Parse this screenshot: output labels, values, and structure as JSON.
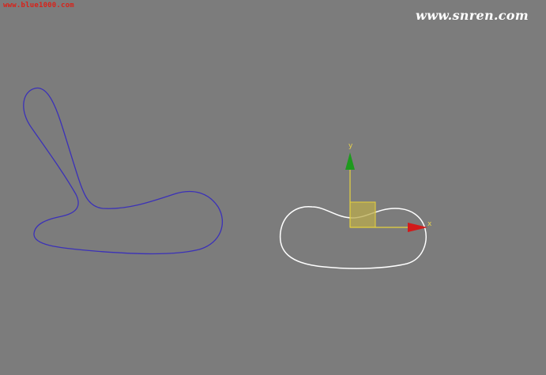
{
  "watermarks": {
    "left": "www.blue1000.com",
    "right": "www.snren.com"
  },
  "gizmo": {
    "y_label": "y",
    "x_label": "x",
    "colors": {
      "y_arrow": "#1e9a1e",
      "x_arrow": "#d21a1a",
      "axis_line": "#e6d23c",
      "plane": "#b9ab4e"
    }
  },
  "shapes": {
    "left_spline_color": "#3b31b8",
    "right_spline_color": "#ffffff"
  },
  "colors": {
    "background": "#7c7c7c"
  }
}
